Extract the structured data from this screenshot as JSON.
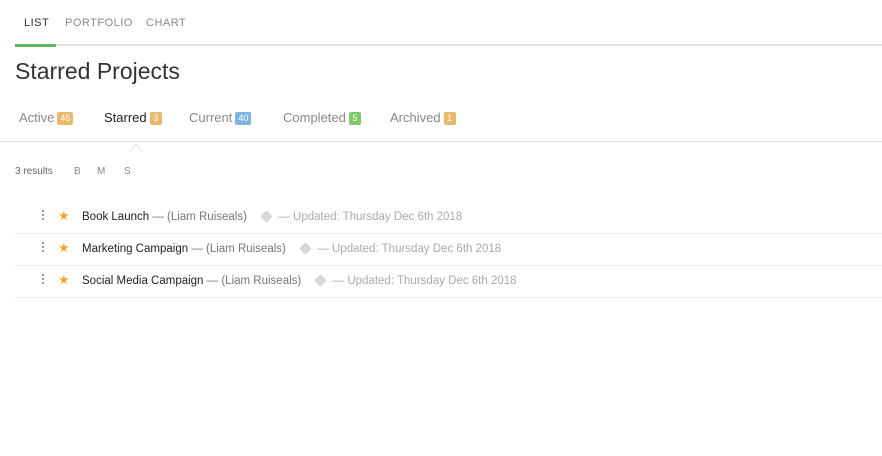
{
  "view_tabs": [
    {
      "label": "LIST",
      "active": true
    },
    {
      "label": "PORTFOLIO",
      "active": false
    },
    {
      "label": "CHART",
      "active": false
    }
  ],
  "page_title": "Starred Projects",
  "filter_tabs": [
    {
      "label": "Active",
      "count": "45",
      "badge_color": "#e8b86d",
      "active": false
    },
    {
      "label": "Starred",
      "count": "3",
      "badge_color": "#e8b86d",
      "active": true
    },
    {
      "label": "Current",
      "count": "40",
      "badge_color": "#7fb3e3",
      "active": false
    },
    {
      "label": "Completed",
      "count": "5",
      "badge_color": "#7ec86e",
      "active": false
    },
    {
      "label": "Archived",
      "count": "1",
      "badge_color": "#e8b86d",
      "active": false
    }
  ],
  "results_text": "3 results",
  "size_options": [
    "B",
    "M",
    "S"
  ],
  "projects": [
    {
      "name": "Book Launch",
      "owner": "— (Liam Ruiseals)",
      "updated": "— Updated: Thursday Dec 6th 2018",
      "starred": true
    },
    {
      "name": "Marketing Campaign",
      "owner": "— (Liam Ruiseals)",
      "updated": "— Updated: Thursday Dec 6th 2018",
      "starred": true
    },
    {
      "name": "Social Media Campaign",
      "owner": "— (Liam Ruiseals)",
      "updated": "— Updated: Thursday Dec 6th 2018",
      "starred": true
    }
  ],
  "icons": {
    "row_menu": "kebab-menu-icon",
    "star": "star-icon",
    "tag": "tag-icon"
  },
  "colors": {
    "accent_green": "#5cb85c",
    "star": "#f5a623"
  }
}
